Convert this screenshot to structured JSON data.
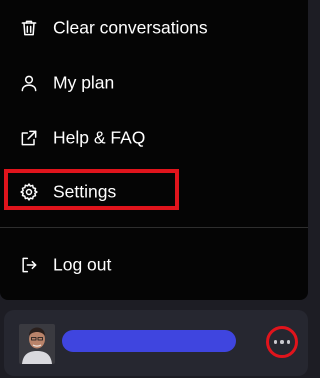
{
  "menu": {
    "items": [
      {
        "label": "Clear conversations",
        "icon": "trash-icon"
      },
      {
        "label": "My plan",
        "icon": "user-icon"
      },
      {
        "label": "Help & FAQ",
        "icon": "external-link-icon"
      },
      {
        "label": "Settings",
        "icon": "gear-icon"
      },
      {
        "label": "Log out",
        "icon": "logout-icon"
      }
    ]
  },
  "colors": {
    "menu_background": "#050505",
    "text": "#ffffff",
    "highlight_annotation": "#e0141c",
    "account_bar_background": "#262730",
    "name_redaction": "#3f45df"
  }
}
